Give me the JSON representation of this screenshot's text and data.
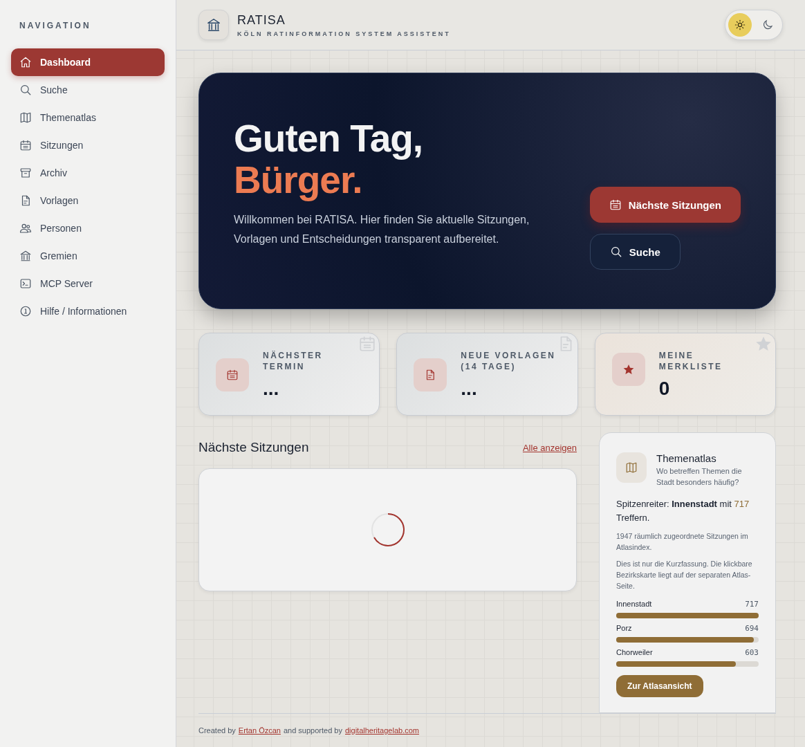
{
  "sidebar": {
    "heading": "NAVIGATION",
    "items": [
      {
        "label": "Dashboard",
        "selected": true
      },
      {
        "label": "Suche",
        "selected": false
      },
      {
        "label": "Themenatlas",
        "selected": false
      },
      {
        "label": "Sitzungen",
        "selected": false
      },
      {
        "label": "Archiv",
        "selected": false
      },
      {
        "label": "Vorlagen",
        "selected": false
      },
      {
        "label": "Personen",
        "selected": false
      },
      {
        "label": "Gremien",
        "selected": false
      },
      {
        "label": "MCP Server",
        "selected": false
      },
      {
        "label": "Hilfe / Informationen",
        "selected": false
      }
    ]
  },
  "header": {
    "title": "RATISA",
    "subtitle": "KÖLN RATINFORMATION SYSTEM ASSISTENT",
    "theme_modes": [
      {
        "kind": "light",
        "selected": true
      },
      {
        "kind": "dark",
        "selected": false
      }
    ]
  },
  "hero": {
    "greeting": "Guten Tag,",
    "name": "Bürger.",
    "text": "Willkommen bei RATISA. Hier finden Sie aktuelle Sitzungen, Vorlagen und Entscheidungen transparent aufbereitet.",
    "buttons": [
      {
        "label": "Nächste Sitzungen",
        "kind": "primary"
      },
      {
        "label": "Suche",
        "kind": "secondary"
      }
    ]
  },
  "stats": [
    {
      "label": "NÄCHSTER TERMIN",
      "value": "..."
    },
    {
      "label": "NEUE VORLAGEN (14 TAGE)",
      "value": "..."
    },
    {
      "label": "MEINE MERKLISTE",
      "value": "0"
    }
  ],
  "sessions": {
    "title": "Nächste Sitzungen",
    "link": "Alle anzeigen",
    "loading": true
  },
  "atlas": {
    "title": "Themenatlas",
    "subtitle": "Wo betreffen Themen die Stadt besonders häufig?",
    "leader": "Spitzenreiter: **Innenstadt** mit",
    "leader_count": "717",
    "leader_suffix": "Treffern.",
    "note_1": "1947 räumlich zugeordnete Sitzungen im Atlasindex.",
    "note_2": "Dies ist nur die Kurzfassung. Die klickbare Bezirkskarte liegt auf der separaten Atlas-Seite.",
    "districts": [
      {
        "name": "Innenstadt",
        "count": "717",
        "level": 1.0
      },
      {
        "name": "Porz",
        "count": "694",
        "level": 0.968
      },
      {
        "name": "Chorweiler",
        "count": "603",
        "level": 0.841
      }
    ],
    "button": "Zur Atlasansicht"
  },
  "footer": {
    "prefix": "Created by",
    "author": "Ertan Özcan",
    "middle": "and supported by",
    "site": "digitalheritagelab.com"
  }
}
